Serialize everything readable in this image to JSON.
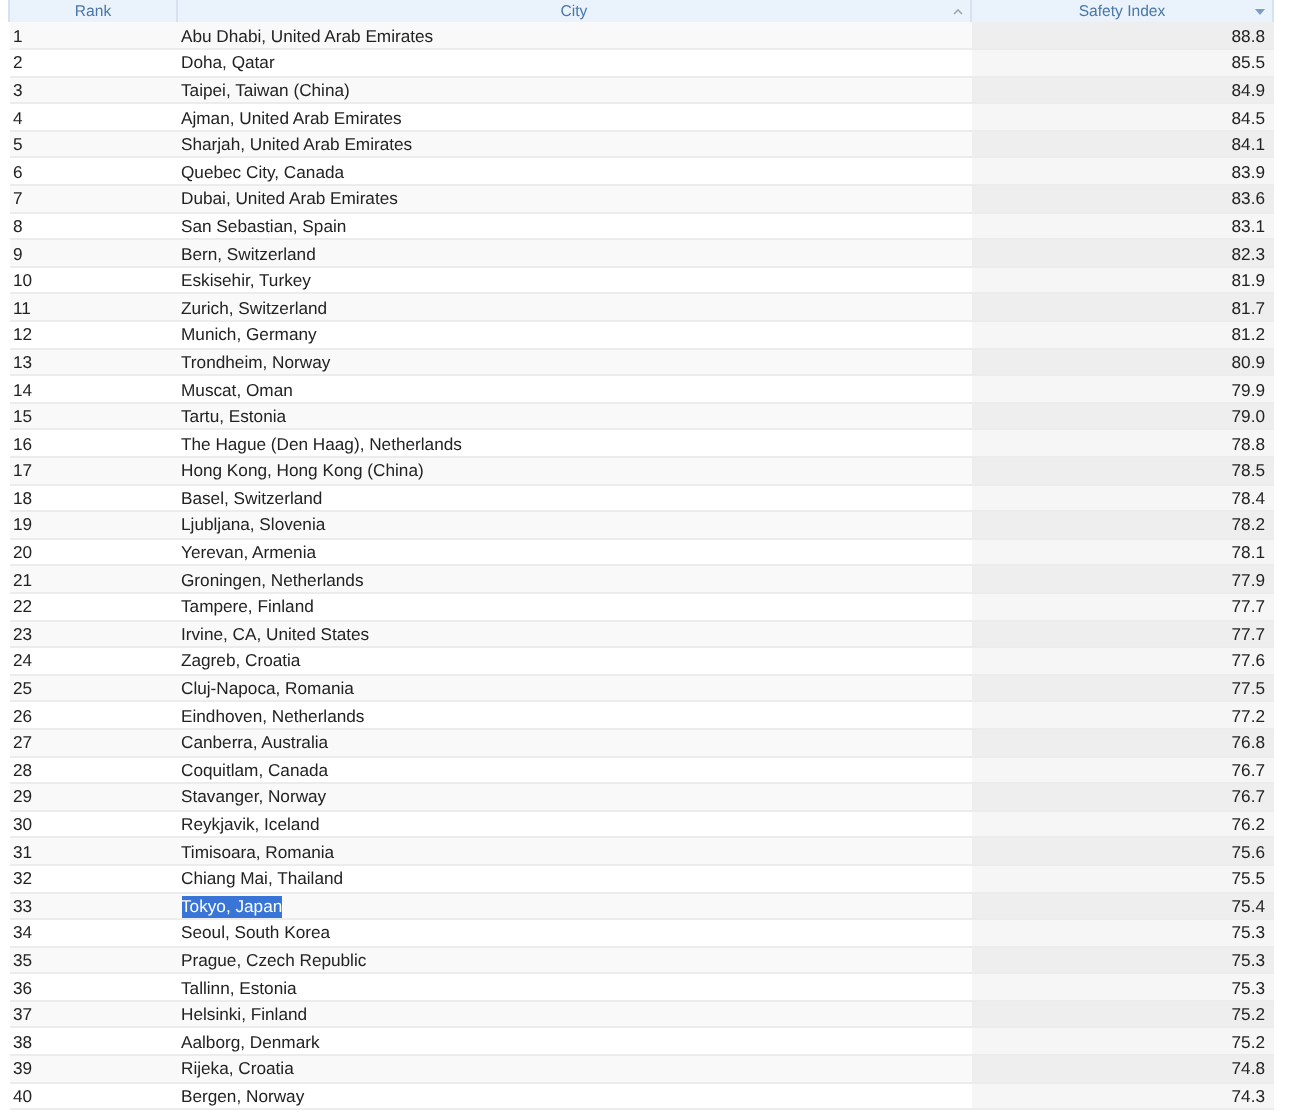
{
  "table": {
    "columns": [
      {
        "label": "Rank",
        "kind": "plain"
      },
      {
        "label": "City",
        "kind": "sortable"
      },
      {
        "label": "Safety Index",
        "kind": "sorted"
      }
    ],
    "rows": [
      {
        "rank": "1",
        "city": "Abu Dhabi, United Arab Emirates",
        "index": "88.8",
        "text_selected": false
      },
      {
        "rank": "2",
        "city": "Doha, Qatar",
        "index": "85.5",
        "text_selected": false
      },
      {
        "rank": "3",
        "city": "Taipei, Taiwan (China)",
        "index": "84.9",
        "text_selected": false
      },
      {
        "rank": "4",
        "city": "Ajman, United Arab Emirates",
        "index": "84.5",
        "text_selected": false
      },
      {
        "rank": "5",
        "city": "Sharjah, United Arab Emirates",
        "index": "84.1",
        "text_selected": false
      },
      {
        "rank": "6",
        "city": "Quebec City, Canada",
        "index": "83.9",
        "text_selected": false
      },
      {
        "rank": "7",
        "city": "Dubai, United Arab Emirates",
        "index": "83.6",
        "text_selected": false
      },
      {
        "rank": "8",
        "city": "San Sebastian, Spain",
        "index": "83.1",
        "text_selected": false
      },
      {
        "rank": "9",
        "city": "Bern, Switzerland",
        "index": "82.3",
        "text_selected": false
      },
      {
        "rank": "10",
        "city": "Eskisehir, Turkey",
        "index": "81.9",
        "text_selected": false
      },
      {
        "rank": "11",
        "city": "Zurich, Switzerland",
        "index": "81.7",
        "text_selected": false
      },
      {
        "rank": "12",
        "city": "Munich, Germany",
        "index": "81.2",
        "text_selected": false
      },
      {
        "rank": "13",
        "city": "Trondheim, Norway",
        "index": "80.9",
        "text_selected": false
      },
      {
        "rank": "14",
        "city": "Muscat, Oman",
        "index": "79.9",
        "text_selected": false
      },
      {
        "rank": "15",
        "city": "Tartu, Estonia",
        "index": "79.0",
        "text_selected": false
      },
      {
        "rank": "16",
        "city": "The Hague (Den Haag), Netherlands",
        "index": "78.8",
        "text_selected": false
      },
      {
        "rank": "17",
        "city": "Hong Kong, Hong Kong (China)",
        "index": "78.5",
        "text_selected": false
      },
      {
        "rank": "18",
        "city": "Basel, Switzerland",
        "index": "78.4",
        "text_selected": false
      },
      {
        "rank": "19",
        "city": "Ljubljana, Slovenia",
        "index": "78.2",
        "text_selected": false
      },
      {
        "rank": "20",
        "city": "Yerevan, Armenia",
        "index": "78.1",
        "text_selected": false
      },
      {
        "rank": "21",
        "city": "Groningen, Netherlands",
        "index": "77.9",
        "text_selected": false
      },
      {
        "rank": "22",
        "city": "Tampere, Finland",
        "index": "77.7",
        "text_selected": false
      },
      {
        "rank": "23",
        "city": "Irvine, CA, United States",
        "index": "77.7",
        "text_selected": false
      },
      {
        "rank": "24",
        "city": "Zagreb, Croatia",
        "index": "77.6",
        "text_selected": false
      },
      {
        "rank": "25",
        "city": "Cluj-Napoca, Romania",
        "index": "77.5",
        "text_selected": false
      },
      {
        "rank": "26",
        "city": "Eindhoven, Netherlands",
        "index": "77.2",
        "text_selected": false
      },
      {
        "rank": "27",
        "city": "Canberra, Australia",
        "index": "76.8",
        "text_selected": false
      },
      {
        "rank": "28",
        "city": "Coquitlam, Canada",
        "index": "76.7",
        "text_selected": false
      },
      {
        "rank": "29",
        "city": "Stavanger, Norway",
        "index": "76.7",
        "text_selected": false
      },
      {
        "rank": "30",
        "city": "Reykjavik, Iceland",
        "index": "76.2",
        "text_selected": false
      },
      {
        "rank": "31",
        "city": "Timisoara, Romania",
        "index": "75.6",
        "text_selected": false
      },
      {
        "rank": "32",
        "city": "Chiang Mai, Thailand",
        "index": "75.5",
        "text_selected": false
      },
      {
        "rank": "33",
        "city": "Tokyo, Japan",
        "index": "75.4",
        "text_selected": true
      },
      {
        "rank": "34",
        "city": "Seoul, South Korea",
        "index": "75.3",
        "text_selected": false
      },
      {
        "rank": "35",
        "city": "Prague, Czech Republic",
        "index": "75.3",
        "text_selected": false
      },
      {
        "rank": "36",
        "city": "Tallinn, Estonia",
        "index": "75.3",
        "text_selected": false
      },
      {
        "rank": "37",
        "city": "Helsinki, Finland",
        "index": "75.2",
        "text_selected": false
      },
      {
        "rank": "38",
        "city": "Aalborg, Denmark",
        "index": "75.2",
        "text_selected": false
      },
      {
        "rank": "39",
        "city": "Rijeka, Croatia",
        "index": "74.8",
        "text_selected": false
      },
      {
        "rank": "40",
        "city": "Bergen, Norway",
        "index": "74.3",
        "text_selected": false
      }
    ]
  }
}
